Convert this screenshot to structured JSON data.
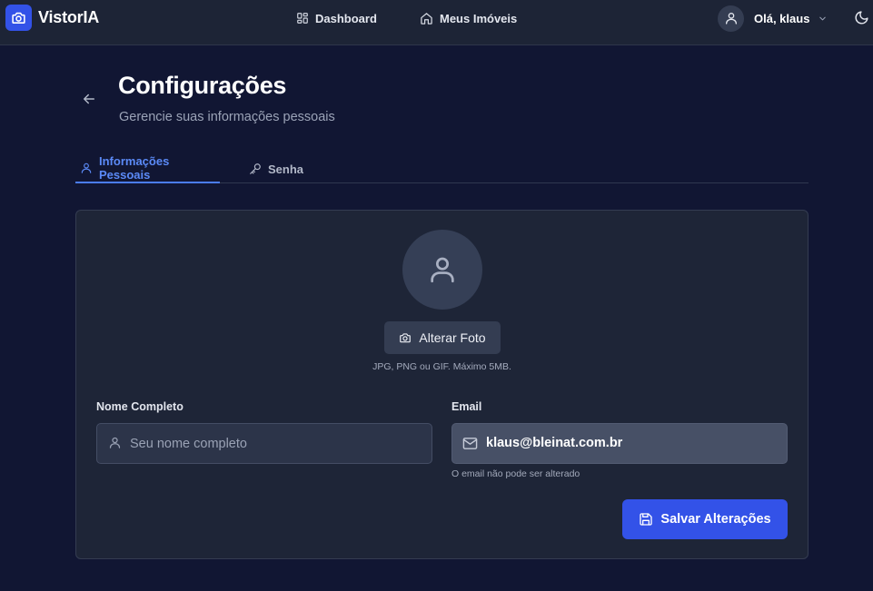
{
  "app": {
    "brand": "VistorIA",
    "brand_color": "#3352e8"
  },
  "nav": {
    "items": [
      {
        "label": "Dashboard",
        "icon": "dashboard-grid-icon"
      },
      {
        "label": "Meus Imóveis",
        "icon": "home-icon"
      }
    ]
  },
  "user_menu": {
    "greeting": "Olá, klaus",
    "avatar_icon": "user-icon",
    "dropdown_icon": "chevron-down-icon"
  },
  "theme_toggle": {
    "icon": "moon-icon"
  },
  "header": {
    "title": "Configurações",
    "subtitle": "Gerencie suas informações pessoais",
    "back_icon": "arrow-left-icon"
  },
  "tabs": [
    {
      "label": "Informações Pessoais",
      "icon": "user-icon",
      "active": true
    },
    {
      "label": "Senha",
      "icon": "key-icon",
      "active": false
    }
  ],
  "profile": {
    "avatar_icon": "user-icon",
    "change_photo_label": "Alterar Foto",
    "change_photo_icon": "camera-icon",
    "photo_hint": "JPG, PNG ou GIF. Máximo 5MB."
  },
  "form": {
    "name": {
      "label": "Nome Completo",
      "placeholder": "Seu nome completo",
      "value": ""
    },
    "email": {
      "label": "Email",
      "value": "klaus@bleinat.com.br",
      "note": "O email não pode ser alterado"
    },
    "save_label": "Salvar Alterações",
    "save_icon": "save-icon"
  }
}
